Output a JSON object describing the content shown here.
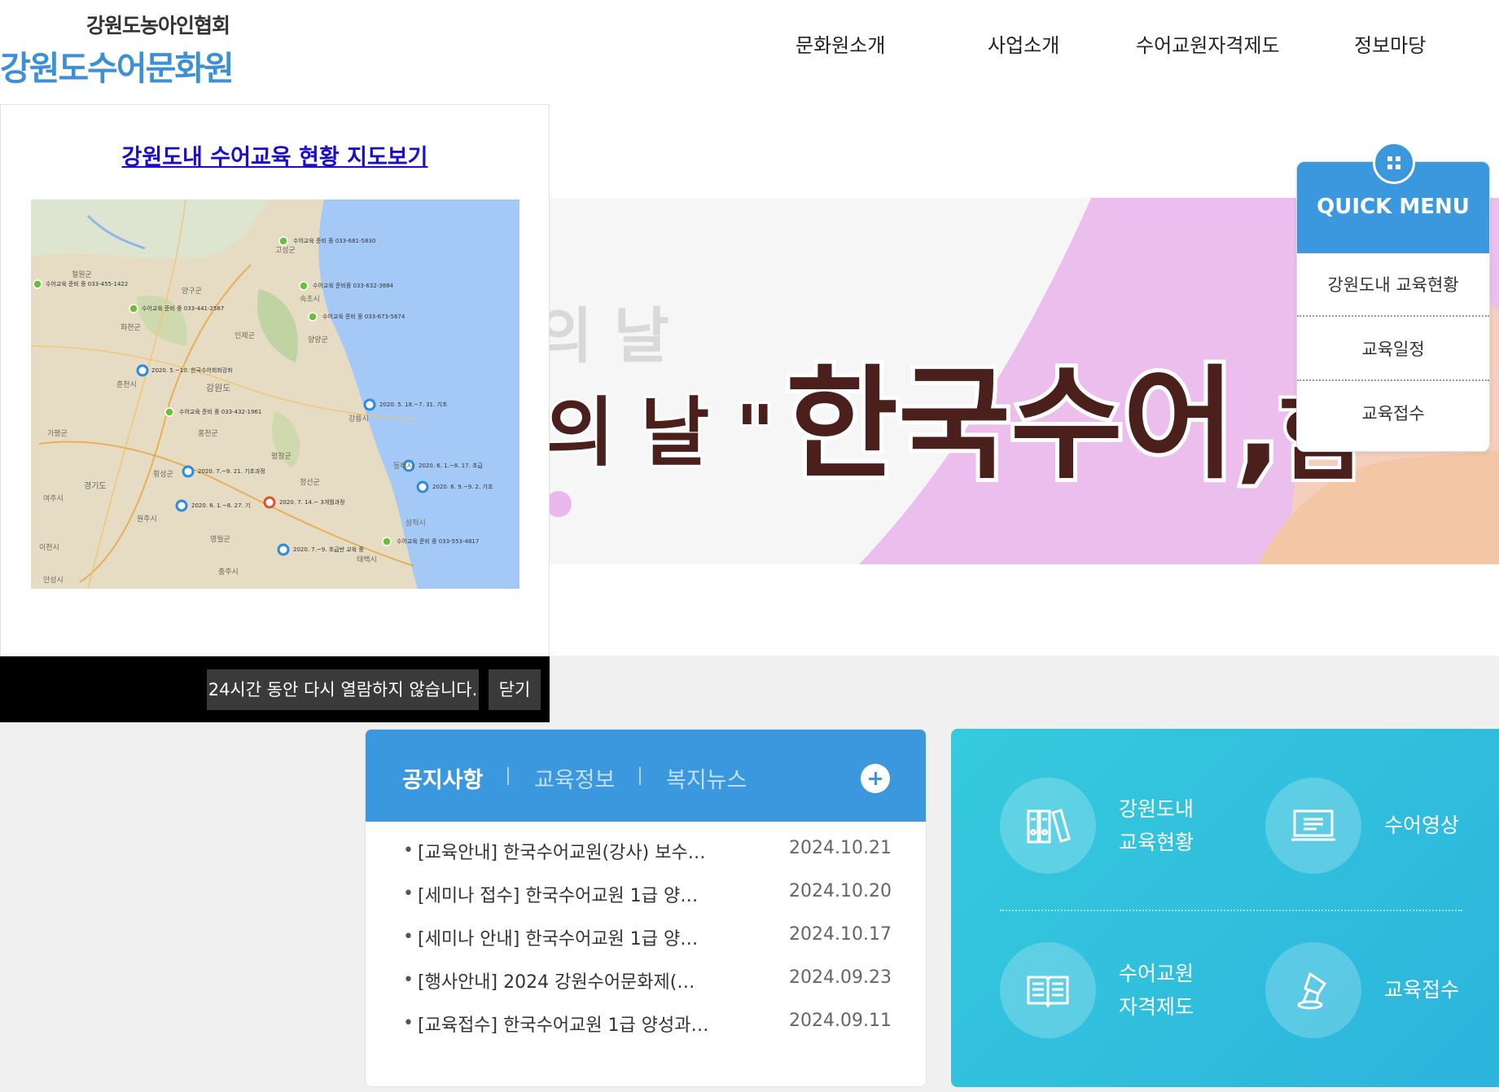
{
  "header": {
    "org_name": "강원도농아인협회",
    "site_name": "강원도수어문화원",
    "nav": [
      "문화원소개",
      "사업소개",
      "수어교원자격제도",
      "정보마당"
    ]
  },
  "banner": {
    "line1": "의 날",
    "line2_prefix": "의 날 \"",
    "line2_main": "한국수어,",
    "line2_tail": "함"
  },
  "popup": {
    "title": "강원도내 수어교육 현황 지도보기",
    "map_labels": [
      "수어교육 준비 중 033-681-5830",
      "수어교육 준비 중 033-455-1422",
      "수어교육 준비중 033-632-3884",
      "수어교육 준비 중 033-441-2587",
      "수어교육 준비 중 033-673-5674",
      "2020. 5.~10. 한국수어회화강좌",
      "2020. 5. 18.~7. 31. 기초",
      "수어교육 준비 중 033-432-1961",
      "2020. 6. 1.~8. 17. 초급",
      "2020. 7.~9. 21. 기초과정",
      "2020. 6. 9.~9. 2. 기초",
      "2020. 6. 1.~8. 27. 기",
      "2020. 7. 14.~ 3개월과정",
      "2020. 7.~9. 초급반 교육 중",
      "수어교육 준비 중 033-553-4817",
      "강원도",
      "춘천시",
      "원주시",
      "강릉시",
      "속초시",
      "동해시",
      "영월군",
      "정선군",
      "홍천군",
      "횡성군",
      "평창군",
      "인제군",
      "양구군",
      "철원군",
      "양양군",
      "삼척시",
      "태백시",
      "가평군",
      "경기도",
      "여주시",
      "이천시",
      "충주시",
      "안성시",
      "화천군",
      "고성군"
    ],
    "dont_show_label": "24시간 동안 다시 열람하지 않습니다.",
    "close_label": "닫기"
  },
  "quick_menu": {
    "title": "QUICK MENU",
    "items": [
      "강원도내 교육현황",
      "교육일정",
      "교육접수"
    ]
  },
  "notice": {
    "tabs": [
      "공지사항",
      "교육정보",
      "복지뉴스"
    ],
    "more_icon": "plus-icon",
    "rows": [
      {
        "title": "[교육안내] 한국수어교원(강사) 보수…",
        "date": "2024.10.21"
      },
      {
        "title": "[세미나 접수] 한국수어교원 1급 양…",
        "date": "2024.10.20"
      },
      {
        "title": "[세미나 안내] 한국수어교원 1급 양…",
        "date": "2024.10.17"
      },
      {
        "title": "[행사안내] 2024 강원수어문화제(…",
        "date": "2024.09.23"
      },
      {
        "title": "[교육접수] 한국수어교원 1급 양성과…",
        "date": "2024.09.11"
      }
    ]
  },
  "quick_links": [
    {
      "line1": "강원도내",
      "line2": "교육현황",
      "icon": "binders-icon"
    },
    {
      "line1": "수어영상",
      "line2": "",
      "icon": "monitor-icon"
    },
    {
      "line1": "수어교원",
      "line2": "자격제도",
      "icon": "book-icon"
    },
    {
      "line1": "교육접수",
      "line2": "",
      "icon": "pen-icon"
    }
  ],
  "colors": {
    "brand_blue": "#3b97de",
    "logo_blue": "#3d8fd6",
    "quick_panel_teal": "#35cadd",
    "popup_link": "#1a0dcc"
  }
}
